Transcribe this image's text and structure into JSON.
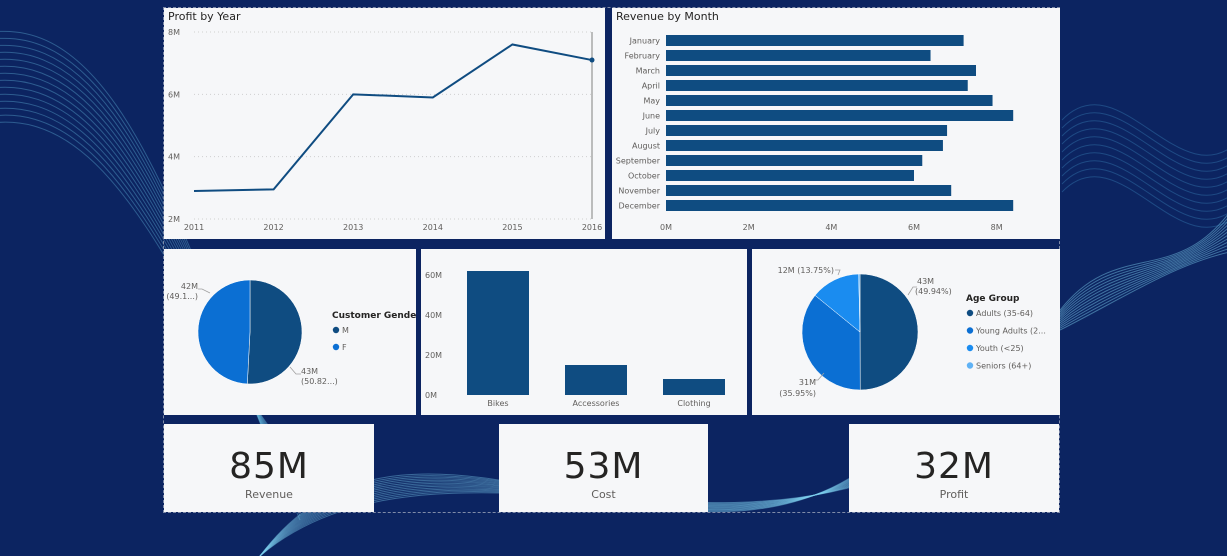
{
  "colors": {
    "background": "#0c2461",
    "panel": "#f6f7f9",
    "series_dark": "#0f4c81",
    "m_gender": "#0f4c81",
    "f_gender": "#0b6fd3",
    "age_adults_35_64": "#0f4c81",
    "age_young_adults": "#0b6fd3",
    "age_youth": "#1a8cf0",
    "age_seniors": "#5fb2f5"
  },
  "kpis": {
    "revenue": {
      "value": "85M",
      "label": "Revenue"
    },
    "cost": {
      "value": "53M",
      "label": "Cost"
    },
    "profit": {
      "value": "32M",
      "label": "Profit"
    }
  },
  "chart_data": [
    {
      "id": "profit_by_year",
      "type": "line",
      "title": "Profit by Year",
      "x": [
        "2011",
        "2012",
        "2013",
        "2014",
        "2015",
        "2016"
      ],
      "values": [
        2.9,
        2.95,
        6.0,
        5.9,
        7.6,
        7.1
      ],
      "y_ticks": [
        "2M",
        "4M",
        "6M",
        "8M"
      ],
      "ylim": [
        2,
        8
      ],
      "unit": "M",
      "grid": true
    },
    {
      "id": "revenue_by_month",
      "type": "bar",
      "orientation": "horizontal",
      "title": "Revenue by Month",
      "categories": [
        "January",
        "February",
        "March",
        "April",
        "May",
        "June",
        "July",
        "August",
        "September",
        "October",
        "November",
        "December"
      ],
      "values": [
        7.2,
        6.4,
        7.5,
        7.3,
        7.9,
        8.4,
        6.8,
        6.7,
        6.2,
        6.0,
        6.9,
        8.4
      ],
      "x_ticks": [
        "0M",
        "2M",
        "4M",
        "6M",
        "8M"
      ],
      "xlim": [
        0,
        9
      ],
      "unit": "M"
    },
    {
      "id": "customer_gender",
      "type": "pie",
      "legend_title": "Customer Gender",
      "slices": [
        {
          "label": "M",
          "value": 50.82,
          "data_label": [
            "43M",
            "(50.82...)"
          ]
        },
        {
          "label": "F",
          "value": 49.18,
          "data_label": [
            "42M",
            "(49.1...)"
          ]
        }
      ],
      "legend_position": "right"
    },
    {
      "id": "revenue_by_category",
      "type": "bar",
      "orientation": "vertical",
      "categories": [
        "Bikes",
        "Accessories",
        "Clothing"
      ],
      "values": [
        62,
        15,
        8
      ],
      "y_ticks": [
        "0M",
        "20M",
        "40M",
        "60M"
      ],
      "ylim": [
        0,
        60
      ],
      "unit": "M"
    },
    {
      "id": "age_group",
      "type": "pie",
      "legend_title": "Age Group",
      "slices": [
        {
          "label": "Adults (35-64)",
          "value": 49.94,
          "data_label": [
            "43M",
            "(49.94%)"
          ]
        },
        {
          "label": "Young Adults (2...",
          "value": 35.95,
          "data_label": [
            "31M",
            "(35.95%)"
          ]
        },
        {
          "label": "Youth (<25)",
          "value": 13.75,
          "data_label": [
            "12M (13.75%)"
          ]
        },
        {
          "label": "Seniors (64+)",
          "value": 0.36,
          "data_label": []
        }
      ],
      "legend_position": "right"
    }
  ]
}
